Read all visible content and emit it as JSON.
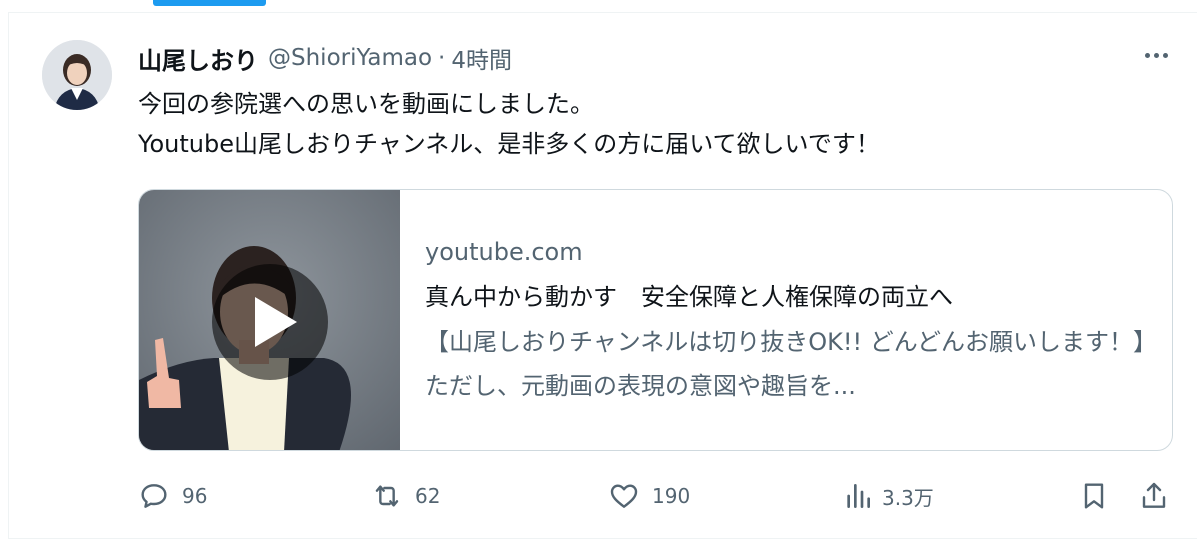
{
  "tweet": {
    "author_name": "山尾しおり",
    "handle": "@ShioriYamao",
    "separator": "·",
    "time": "4時間",
    "text_line1": "今回の参院選への思いを動画にしました。",
    "text_line2": "Youtube山尾しおりチャンネル、是非多くの方に届いて欲しいです！"
  },
  "card": {
    "domain": "youtube.com",
    "title": "真ん中から動かす　安全保障と人権保障の両立へ",
    "description": "【山尾しおりチャンネルは切り抜きOK!! どんどんお願いします！】ただし、元動画の表現の意図や趣旨を..."
  },
  "actions": {
    "replies": "96",
    "retweets": "62",
    "likes": "190",
    "views": "3.3万"
  },
  "icons": {
    "more": "more-icon",
    "reply": "reply-icon",
    "retweet": "retweet-icon",
    "like": "heart-icon",
    "views": "views-icon",
    "bookmark": "bookmark-icon",
    "share": "share-icon",
    "play": "play-icon"
  },
  "colors": {
    "accent": "#1d9bf0",
    "text": "#0f1419",
    "secondary": "#536471",
    "border": "#cfd9de"
  }
}
